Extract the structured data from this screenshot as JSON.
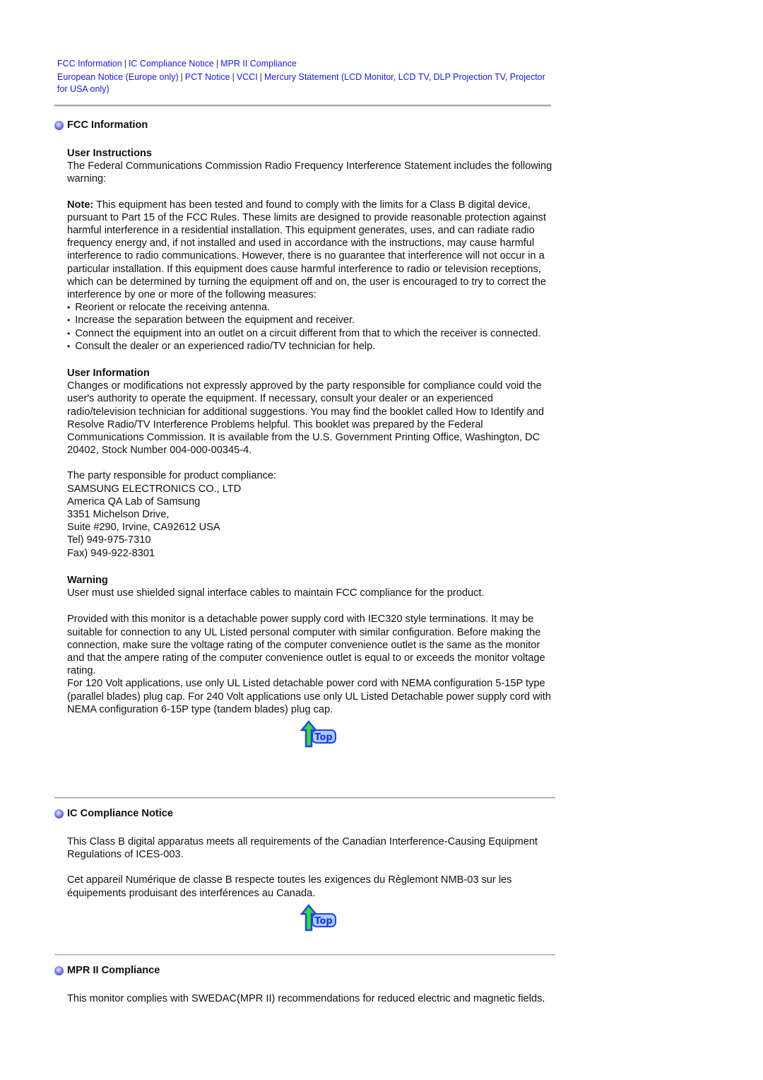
{
  "nav": {
    "row1": [
      "FCC Information",
      "IC Compliance Notice",
      "MPR II Compliance"
    ],
    "row2": [
      "European Notice (Europe only)",
      "PCT Notice",
      "VCCI",
      "Mercury Statement (LCD Monitor, LCD TV, DLP Projection TV, Projector for USA only)"
    ]
  },
  "fcc": {
    "title": "FCC Information",
    "user_instructions_heading": "User Instructions",
    "intro": "The Federal Communications Commission Radio Frequency Interference Statement includes the following warning:",
    "note_label": "Note:",
    "note_text": " This equipment has been tested and found to comply with the limits for a Class B digital device, pursuant to Part 15 of the FCC Rules. These limits are designed to provide reasonable protection against harmful interference in a residential installation. This equipment generates, uses, and can radiate radio frequency energy and, if not installed and used in accordance with the instructions, may cause harmful interference to radio communications. However, there is no guarantee that interference will not occur in a particular installation. If this equipment does cause harmful interference to radio or television receptions, which can be determined by turning the equipment off and on, the user is encouraged to try to correct the interference by one or more of the following measures:",
    "measures": [
      "Reorient or relocate the receiving antenna.",
      "Increase the separation between the equipment and receiver.",
      "Connect the equipment into an outlet on a circuit different from that to which the receiver is connected.",
      "Consult the dealer or an experienced radio/TV technician for help."
    ],
    "user_information_heading": "User Information",
    "user_information": "Changes or modifications not expressly approved by the party responsible for compliance could void the user's authority to operate the equipment. If necessary, consult your dealer or an experienced radio/television technician for additional suggestions. You may find the booklet called How to Identify and Resolve Radio/TV Interference Problems helpful. This booklet was prepared by the Federal Communications Commission. It is available from the U.S. Government Printing Office, Washington, DC 20402, Stock Number 004-000-00345-4.",
    "party_lines": [
      "The party responsible for product compliance:",
      "SAMSUNG ELECTRONICS CO., LTD",
      "America QA Lab of Samsung",
      "3351 Michelson Drive,",
      "Suite #290, Irvine, CA92612 USA",
      "Tel) 949-975-7310",
      "Fax) 949-922-8301"
    ],
    "warning_heading": "Warning",
    "warning_text": "User must use shielded signal interface cables to maintain FCC compliance for the product.",
    "power_cord_1": "Provided with this monitor is a detachable power supply cord with IEC320 style terminations. It may be suitable for connection to any UL Listed personal computer with similar configuration. Before making the connection, make sure the voltage rating of the computer convenience outlet is the same as the monitor and that the ampere rating of the computer convenience outlet is equal to or exceeds the monitor voltage rating.",
    "power_cord_2": "For 120 Volt applications, use only UL Listed detachable power cord with NEMA configuration 5-15P type (parallel blades) plug cap. For 240 Volt applications use only UL Listed Detachable power supply cord with NEMA configuration 6-15P type (tandem blades) plug cap.",
    "top_label": "Top"
  },
  "ic": {
    "title": "IC Compliance Notice",
    "en": "This Class B digital apparatus meets all requirements of the Canadian Interference-Causing Equipment Regulations of ICES-003.",
    "fr": "Cet appareil Numérique de classe B respecte toutes les exigences du Règlemont NMB-03 sur les équipements produisant des interférences au Canada.",
    "top_label": "Top"
  },
  "mpr": {
    "title": "MPR II Compliance",
    "text": "This monitor complies with SWEDAC(MPR II) recommendations for reduced electric and magnetic fields."
  }
}
